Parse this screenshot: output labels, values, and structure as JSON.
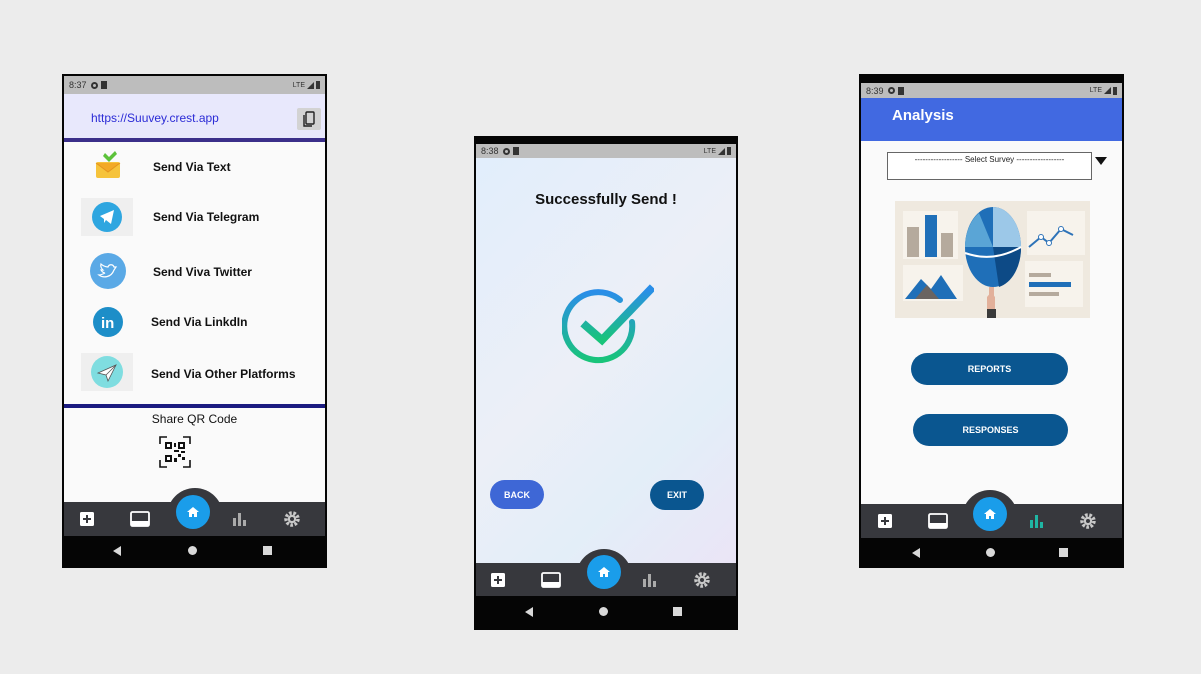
{
  "phone1": {
    "status": {
      "time": "8:37",
      "network": "LTE"
    },
    "url": "https://Suuvey.crest.app",
    "share_options": [
      {
        "label": "Send Via Text",
        "icon": "mail-icon"
      },
      {
        "label": "Send Via Telegram",
        "icon": "telegram-icon"
      },
      {
        "label": "Send Viva Twitter",
        "icon": "twitter-icon"
      },
      {
        "label": "Send Via LinkdIn",
        "icon": "linkedin-icon"
      },
      {
        "label": "Send Via Other Platforms",
        "icon": "paper-plane-icon"
      }
    ],
    "qr_label": "Share QR Code"
  },
  "phone2": {
    "status": {
      "time": "8:38",
      "network": "LTE"
    },
    "message": "Successfully Send !",
    "back_label": "BACK",
    "exit_label": "EXIT"
  },
  "phone3": {
    "status": {
      "time": "8:39",
      "network": "LTE"
    },
    "title": "Analysis",
    "select_placeholder": "------------------ Select Survey ------------------",
    "reports_label": "REPORTS",
    "responses_label": "RESPONSES"
  },
  "colors": {
    "home_button": "#1a9dea",
    "app_bar": "#4169e1",
    "primary_button": "#0a5690",
    "back_button": "#3e67d6",
    "nav_bar": "#37383d",
    "active_nav": "#1fb5a3"
  }
}
